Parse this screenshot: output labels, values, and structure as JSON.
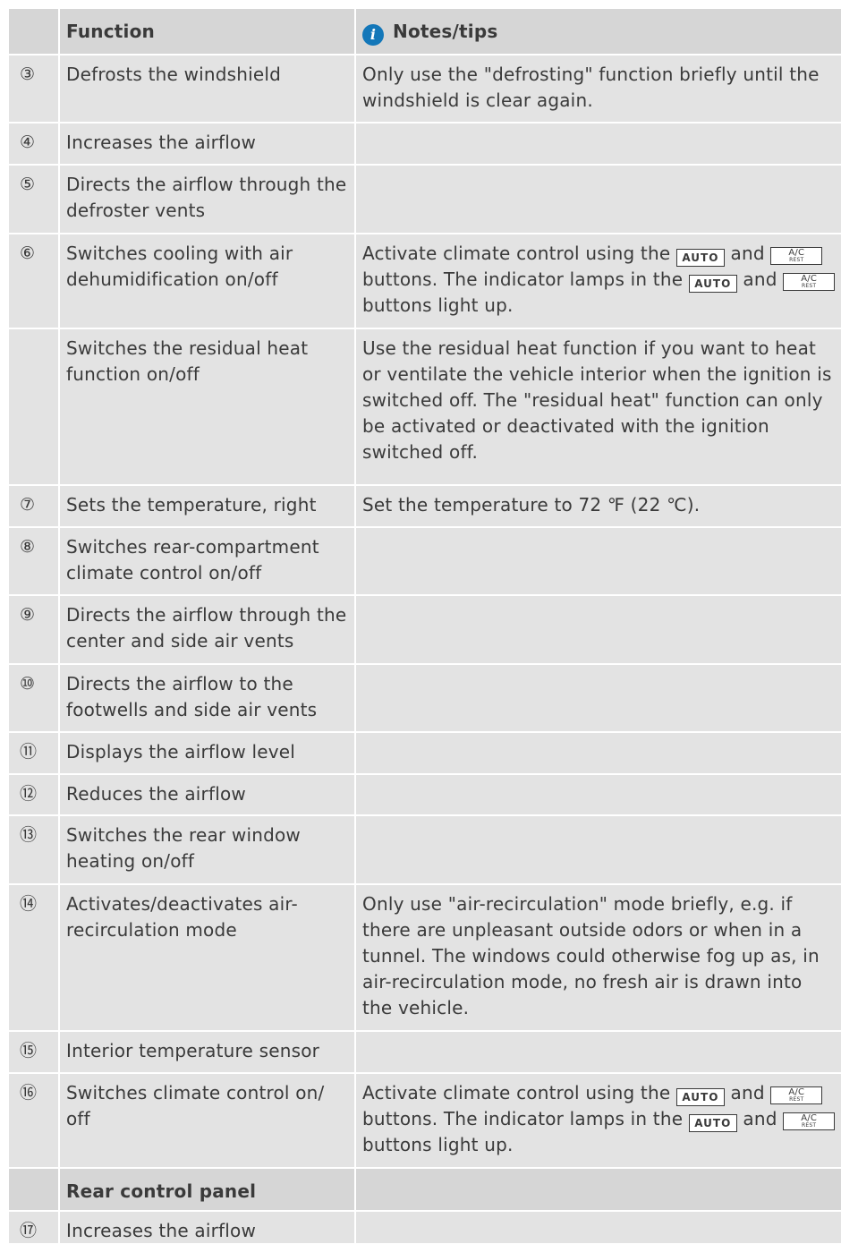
{
  "header": {
    "col_function": "Function",
    "col_notes": "Notes/tips",
    "notes_icon": "info-icon"
  },
  "rows": [
    {
      "num": "③",
      "function": "Defrosts the windshield",
      "notes": "Only use the \"defrosting\" function briefly until the windshield is clear again."
    },
    {
      "num": "④",
      "function": "Increases the airflow",
      "notes": ""
    },
    {
      "num": "⑤",
      "function": "Directs the airflow through the defroster vents",
      "notes": ""
    },
    {
      "num": "⑥",
      "function": "Switches cooling with air dehumidification on/off",
      "notes_parts": [
        "Activate climate control using the",
        "and",
        "buttons. The indicator lamps in the",
        "and",
        "buttons light up."
      ]
    },
    {
      "num": "",
      "function": "Switches the residual heat function on/off",
      "notes": "Use the residual heat function if you want to heat or ventilate the vehicle interior when the ignition is switched off. The \"residual heat\" function can only be activated or deactivated with the ignition switched off."
    },
    {
      "num": "⑦",
      "function": "Sets the temperature, right",
      "notes": "Set the temperature to 72 ℉ (22 ℃)."
    },
    {
      "num": "⑧",
      "function": "Switches rear-compartment climate control on/off",
      "notes": ""
    },
    {
      "num": "⑨",
      "function": "Directs the airflow through the center and side air vents",
      "notes": ""
    },
    {
      "num": "⑩",
      "function": "Directs the airflow to the footwells and side air vents",
      "notes": ""
    },
    {
      "num": "⑪",
      "function": "Displays the airflow level",
      "notes": ""
    },
    {
      "num": "⑫",
      "function": "Reduces the airflow",
      "notes": ""
    },
    {
      "num": "⑬",
      "function": "Switches the rear window heating on/off",
      "notes": ""
    },
    {
      "num": "⑭",
      "function": "Activates/deactivates air-recirculation mode",
      "notes": "Only use \"air-recirculation\" mode briefly, e.g. if there are unpleasant outside odors or when in a tunnel. The windows could otherwise fog up as, in air-recirculation mode, no fresh air is drawn into the vehicle."
    },
    {
      "num": "⑮",
      "function": "Interior temperature sensor",
      "notes": ""
    },
    {
      "num": "⑯",
      "function": "Switches climate control on/ off",
      "notes_parts": [
        "Activate climate control using the",
        "and",
        "buttons. The indicator lamps in the",
        "and",
        "buttons light up."
      ]
    },
    {
      "num": "",
      "function": "Rear control panel",
      "notes": "",
      "section": true
    },
    {
      "num": "⑰",
      "function": "Increases the airflow",
      "notes": ""
    }
  ],
  "keys": {
    "auto": "AUTO",
    "ac": "A/C",
    "ac_sub": "REST"
  }
}
